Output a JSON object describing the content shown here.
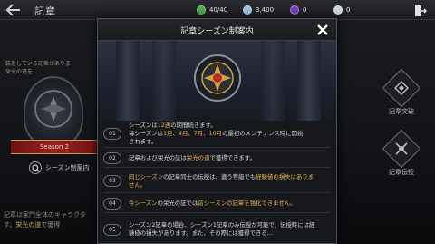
{
  "header": {
    "title": "記章",
    "currencies": [
      {
        "icon": "stamina-icon",
        "value": "40/40",
        "color": "#4caf50"
      },
      {
        "icon": "gem-icon",
        "value": "3,400",
        "color": "#9fc4e8"
      },
      {
        "icon": "purple-stone-icon",
        "value": "0",
        "color": "#7a3fc2"
      },
      {
        "icon": "silver-coin-icon",
        "value": "0",
        "color": "#cfd6de"
      }
    ]
  },
  "left_panel": {
    "desc_line1": "装着している記章がありま",
    "desc_line2": "栄光の道を…",
    "season_label": "Season 2",
    "season_button": "シーズン制案内",
    "bottom_line1": "記章は家門全体のキャラクタ",
    "bottom_line2_pre": "す。",
    "bottom_line2_hl": "栄光の道",
    "bottom_line2_post": "で獲得"
  },
  "side_buttons": {
    "upgrade": "記章突破",
    "inherit": "記章伝授"
  },
  "modal": {
    "title": "記章シーズン制案内",
    "rules": [
      {
        "num": "01",
        "l1_pre": "シーズンは",
        "l1_hl": "12週",
        "l1_post": "の期間続きます。",
        "l2_pre": "毎シーズンは",
        "l2_hl": "1月、4月、7月、10月",
        "l2_post": "の最初のメンテナンス時に開始",
        "l3": "されます。"
      },
      {
        "num": "02",
        "pre": "記章および栄光の証は",
        "hl": "栄光の道",
        "post": "で獲得できます。"
      },
      {
        "num": "03",
        "hl": "同じシーズン",
        "mid": "の記章同士の伝授は、違う等級でも",
        "hl2": "経験値の損失はありま",
        "l2": "せん。"
      },
      {
        "num": "04",
        "hl": "今シーズン",
        "mid": "の栄光の証では",
        "hl2": "前シーズンの記章を強化できません。"
      },
      {
        "num": "05",
        "l1": "シーズン2記章の場合、シーズン1記章のみ伝授が可能で、伝授時には経",
        "l2": "験値の損失があります。また、その際には獲得できる…"
      }
    ]
  }
}
